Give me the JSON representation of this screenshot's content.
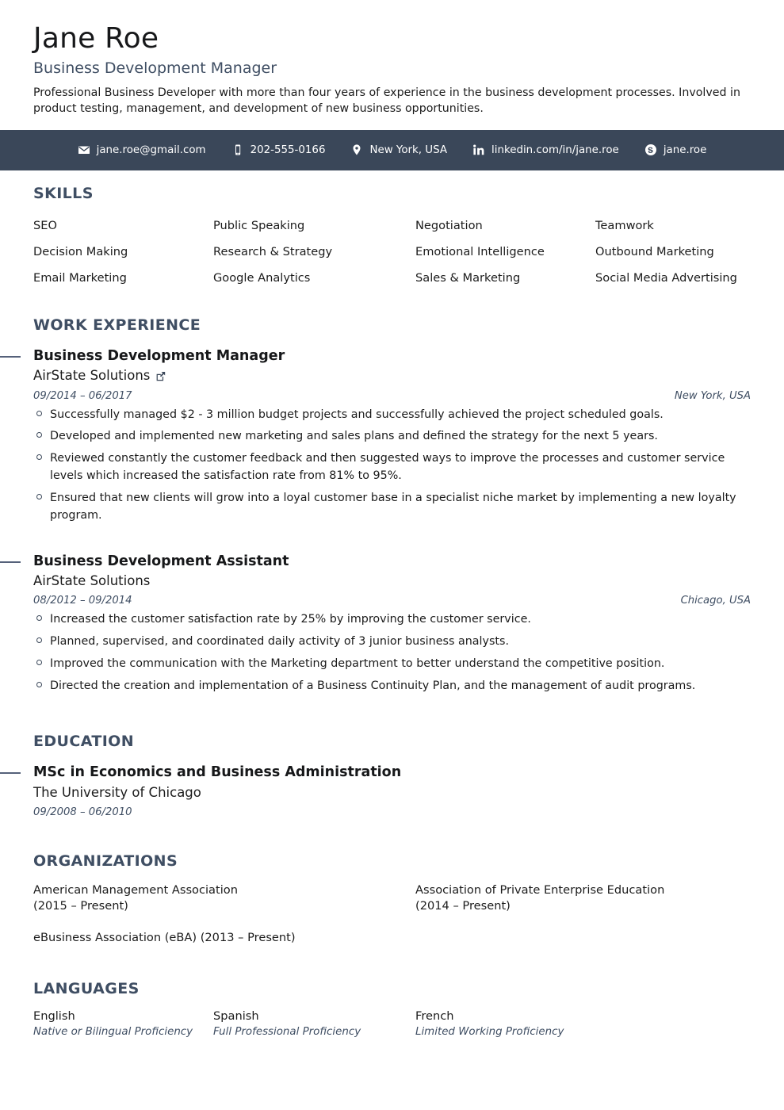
{
  "header": {
    "name": "Jane Roe",
    "title": "Business Development Manager",
    "summary": "Professional Business Developer with more than four years of experience in the business development processes. Involved in product testing, management, and development of new business opportunities."
  },
  "contact": {
    "items": [
      {
        "icon": "envelope-icon",
        "value": "jane.roe@gmail.com"
      },
      {
        "icon": "mobile-phone-icon",
        "value": "202-555-0166"
      },
      {
        "icon": "map-pin-icon",
        "value": "New York, USA"
      },
      {
        "icon": "linkedin-icon",
        "value": "linkedin.com/in/jane.roe"
      },
      {
        "icon": "skype-icon",
        "value": "jane.roe"
      }
    ],
    "bar_color": "#3a4759",
    "text_color": "#ffffff"
  },
  "sections": {
    "skills": {
      "heading": "SKILLS",
      "items": [
        "SEO",
        "Public Speaking",
        "Negotiation",
        "Teamwork",
        "Decision Making",
        "Research & Strategy",
        "Emotional Intelligence",
        "Outbound Marketing",
        "Email Marketing",
        "Google Analytics",
        "Sales & Marketing",
        "Social Media Advertising"
      ]
    },
    "work": {
      "heading": "WORK EXPERIENCE",
      "entries": [
        {
          "role": "Business Development Manager",
          "company": "AirState Solutions",
          "has_link_icon": true,
          "link_icon": "external-link-icon",
          "dates": "09/2014 – 06/2017",
          "location": "New York, USA",
          "bullets": [
            "Successfully managed $2 - 3 million budget projects and successfully achieved the project scheduled goals.",
            "Developed and implemented new marketing and sales plans and defined the strategy for the next 5 years.",
            "Reviewed constantly the customer feedback and then suggested ways to improve the processes and customer service levels which increased the satisfaction rate from 81% to 95%.",
            "Ensured that new clients will grow into a loyal customer base in a specialist niche market by implementing a new loyalty program."
          ]
        },
        {
          "role": "Business Development Assistant",
          "company": "AirState Solutions",
          "has_link_icon": false,
          "link_icon": "",
          "dates": "08/2012 – 09/2014",
          "location": "Chicago, USA",
          "bullets": [
            "Increased the customer satisfaction rate by 25% by improving the customer service.",
            "Planned, supervised, and coordinated daily activity of 3 junior business analysts.",
            "Improved the communication with the Marketing department to better understand the competitive position.",
            "Directed the creation and implementation of a Business Continuity Plan, and the management of audit programs."
          ]
        }
      ]
    },
    "education": {
      "heading": "EDUCATION",
      "entries": [
        {
          "degree": "MSc in Economics and Business Administration",
          "school": "The University of Chicago",
          "dates": "09/2008 – 06/2010"
        }
      ]
    },
    "organizations": {
      "heading": "ORGANIZATIONS",
      "items": [
        "American Management Association\n(2015 – Present)",
        "Association of Private Enterprise Education\n(2014 – Present)",
        "eBusiness Association (eBA) (2013 – Present)"
      ]
    },
    "languages": {
      "heading": "LANGUAGES",
      "items": [
        {
          "name": "English",
          "level": "Native or Bilingual Proficiency"
        },
        {
          "name": "Spanish",
          "level": "Full Professional Proficiency"
        },
        {
          "name": "French",
          "level": "Limited Working Proficiency"
        }
      ]
    }
  }
}
